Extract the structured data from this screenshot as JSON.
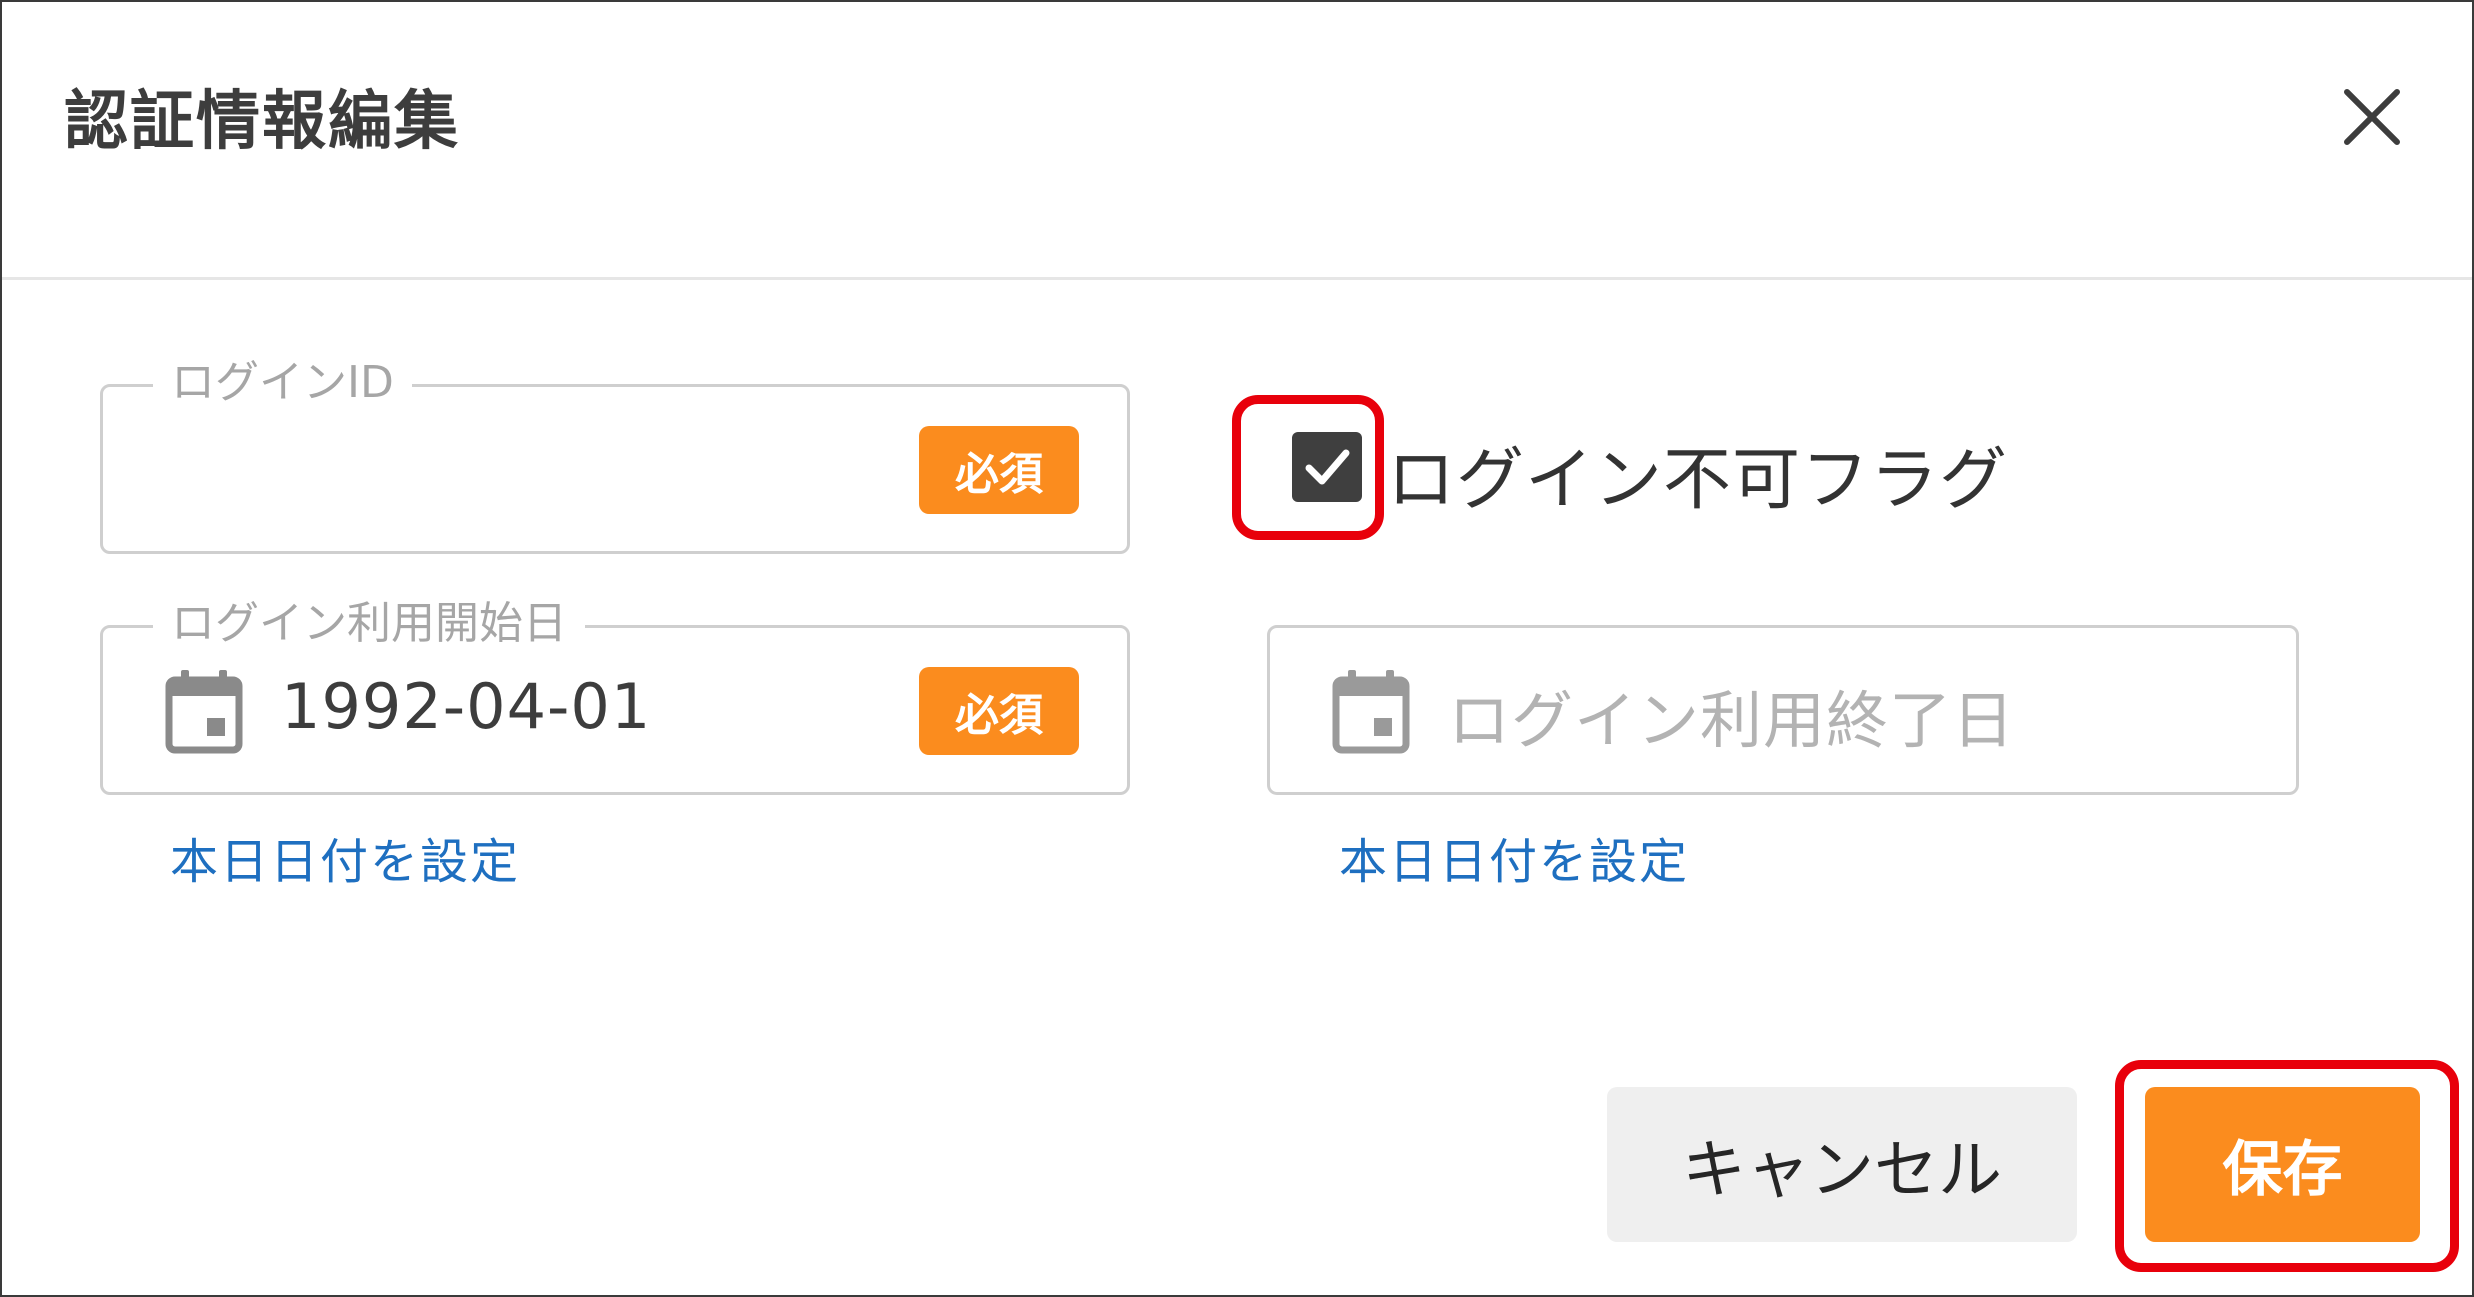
{
  "dialog": {
    "title": "認証情報編集",
    "close_icon": "close-icon"
  },
  "form": {
    "login_id": {
      "label": "ログインID",
      "value": "",
      "required_badge": "必須"
    },
    "login_disabled_flag": {
      "label": "ログイン不可フラグ",
      "checked": true
    },
    "start_date": {
      "label": "ログイン利用開始日",
      "value": "1992-04-01",
      "required_badge": "必須",
      "icon": "calendar-icon",
      "set_today_link": "本日日付を設定"
    },
    "end_date": {
      "placeholder": "ログイン利用終了日",
      "value": "",
      "icon": "calendar-icon",
      "set_today_link": "本日日付を設定"
    }
  },
  "actions": {
    "cancel_label": "キャンセル",
    "save_label": "保存"
  },
  "colors": {
    "accent": "#fb8c1e",
    "link": "#1e6fc0",
    "highlight": "#e8000b",
    "checkbox": "#3f3f3f"
  }
}
